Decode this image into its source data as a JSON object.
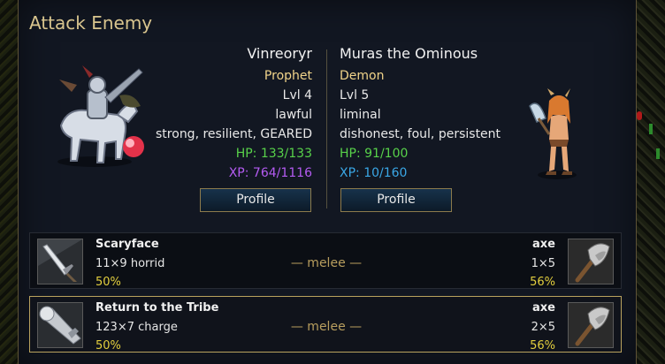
{
  "dialog": {
    "title": "Attack Enemy"
  },
  "attacker": {
    "name": "Vinreoryr",
    "class": "Prophet",
    "level": "Lvl 4",
    "alignment": "lawful",
    "traits": "strong, resilient, GEARED",
    "hp": "HP: 133/133",
    "xp": "XP: 764/1116",
    "profile_label": "Profile",
    "portrait_icon": "mounted-knight-unit-icon"
  },
  "defender": {
    "name": "Muras the Ominous",
    "class": "Demon",
    "level": "Lvl 5",
    "alignment": "liminal",
    "traits": "dishonest, foul, persistent",
    "hp": "HP: 91/100",
    "xp": "XP: 10/160",
    "profile_label": "Profile",
    "portrait_icon": "demon-unit-icon"
  },
  "attacks": [
    {
      "attacker_weapon": "Scaryface",
      "attacker_damage": "11×9 horrid",
      "attacker_chance": "50%",
      "range": "— melee —",
      "defender_weapon": "axe",
      "defender_damage": "1×5",
      "defender_chance": "56%",
      "attacker_icon": "sword-icon",
      "defender_icon": "axe-icon"
    },
    {
      "attacker_weapon": "Return to the Tribe",
      "attacker_damage": "123×7 charge",
      "attacker_chance": "50%",
      "range": "— melee —",
      "defender_weapon": "axe",
      "defender_damage": "2×5",
      "defender_chance": "56%",
      "attacker_icon": "lance-icon",
      "defender_icon": "axe-icon"
    }
  ],
  "colors": {
    "title": "#d9c58e",
    "hp": "#58d24a",
    "xp_attacker": "#b45bf2",
    "xp_defender": "#3aa7e6",
    "chance": "#e3cf3e",
    "selected_border": "#b9a25e"
  }
}
